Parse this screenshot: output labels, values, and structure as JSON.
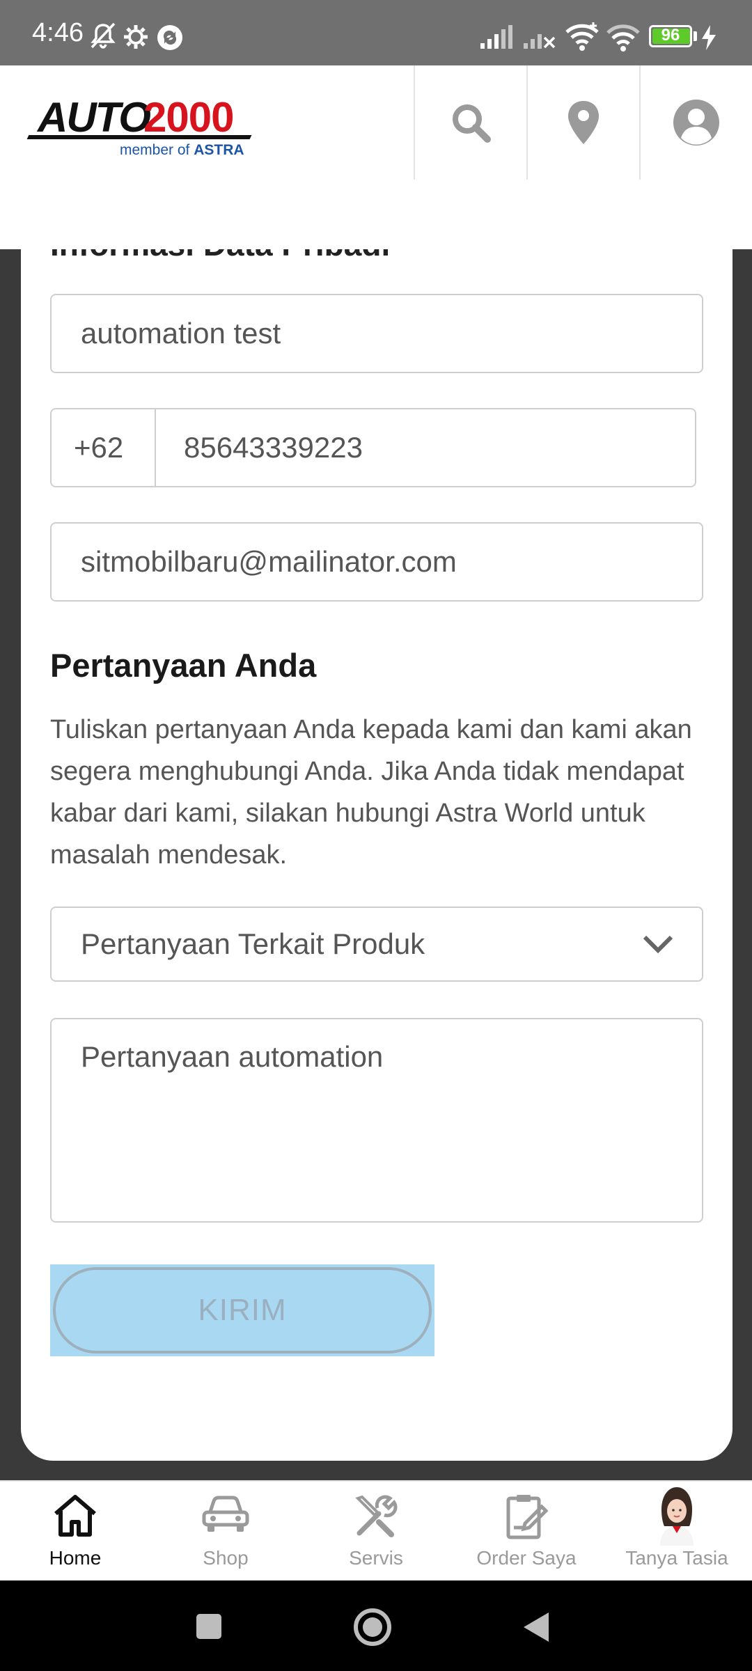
{
  "status_bar": {
    "time": "4:46",
    "battery": "96",
    "battery_level": 0.96
  },
  "header": {
    "logo": {
      "brand_word": "AUTO",
      "brand_number": "2000",
      "tagline_prefix": "member of",
      "tagline_brand": "ASTRA"
    },
    "icons": [
      "search-icon",
      "location-pin-icon",
      "user-profile-icon"
    ]
  },
  "form": {
    "section_title": "Informasi Data Pribadi",
    "name_value": "automation test",
    "phone_code": "+62",
    "phone_value": "85643339223",
    "email_value": "sitmobilbaru@mailinator.com",
    "question_heading": "Pertanyaan Anda",
    "question_description": "Tuliskan pertanyaan Anda kepada kami dan kami akan segera menghubungi Anda. Jika Anda tidak mendapat kabar dari kami, silakan hubungi Astra World untuk masalah mendesak.",
    "category_selected": "Pertanyaan Terkait Produk",
    "question_value": "Pertanyaan automation",
    "submit_label": "KIRIM"
  },
  "bottom_nav": {
    "items": [
      {
        "label": "Home",
        "icon": "home-icon",
        "active": true
      },
      {
        "label": "Shop",
        "icon": "car-icon",
        "active": false
      },
      {
        "label": "Servis",
        "icon": "tools-icon",
        "active": false
      },
      {
        "label": "Order Saya",
        "icon": "order-clipboard-icon",
        "active": false
      },
      {
        "label": "Tanya Tasia",
        "icon": "assistant-avatar-icon",
        "active": false
      }
    ]
  },
  "colors": {
    "brand_red": "#d7141e",
    "brand_blue": "#1d55a6",
    "submit_bg": "#a9d8f2",
    "status_bar": "#707070"
  }
}
